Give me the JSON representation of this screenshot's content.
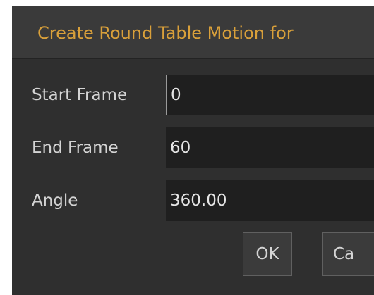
{
  "dialog": {
    "title": "Create Round Table Motion for"
  },
  "fields": [
    {
      "label": "Start Frame",
      "value": "0"
    },
    {
      "label": "End Frame",
      "value": "60"
    },
    {
      "label": "Angle",
      "value": "360.00"
    }
  ],
  "buttons": {
    "ok_label": "OK",
    "cancel_label": "Ca"
  },
  "colors": {
    "title": "#d9a03a",
    "background": "#2f2f2f",
    "field_background": "#1f1f1f",
    "text": "#d4d4d4"
  }
}
